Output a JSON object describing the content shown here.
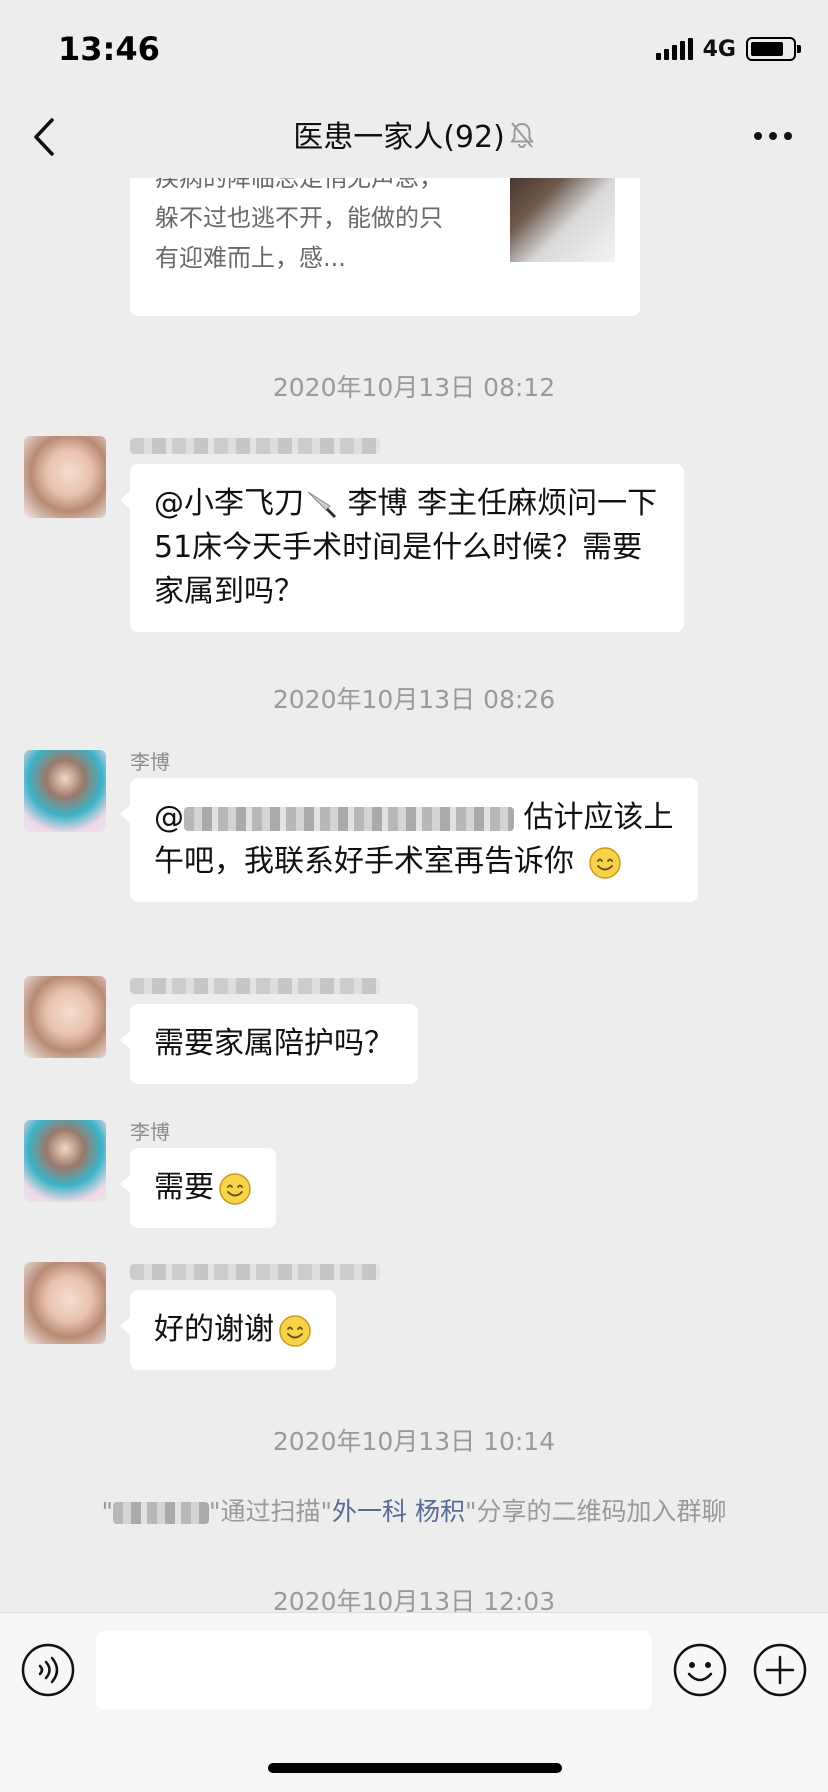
{
  "status_bar": {
    "time": "13:46",
    "network": "4G",
    "battery_level": 0.8
  },
  "nav": {
    "back_icon": "chevron-left-icon",
    "title": "医患一家人(92)",
    "mute_icon": "bell-mute-icon",
    "more_icon": "more-dots-icon"
  },
  "article": {
    "text": "疾病的降临总是悄无声息，躲不过也逃不开，能做的只有迎难而上，感..."
  },
  "messages": [
    {
      "timestamp": "2020年10月13日 08:12"
    },
    {
      "sender": "",
      "mention": "@小李飞刀",
      "knife_icon": "knife-icon",
      "text": "李博 李主任麻烦问一下51床今天手术时间是什么时候？需要家属到吗？"
    },
    {
      "timestamp": "2020年10月13日 08:26"
    },
    {
      "sender": "李博",
      "prefix": "@",
      "text": "估计应该上午吧，我联系好手术室再告诉你",
      "emoji": "smile-emoji"
    },
    {
      "sender": "",
      "text": "需要家属陪护吗？"
    },
    {
      "sender": "李博",
      "text": "需要",
      "emoji": "smile-emoji"
    },
    {
      "sender": "",
      "text": "好的谢谢",
      "emoji": "smile-emoji"
    },
    {
      "timestamp": "2020年10月13日 10:14"
    },
    {
      "system": {
        "q_open": "\"",
        "middle": "\"通过扫描\"",
        "link": "外一科  杨积",
        "tail": "\"分享的二维码加入群聊"
      }
    },
    {
      "timestamp": "2020年10月13日 12:03"
    }
  ],
  "input_bar": {
    "voice_icon": "voice-icon",
    "input_value": "",
    "emoji_icon": "emoji-icon",
    "plus_icon": "plus-icon"
  }
}
